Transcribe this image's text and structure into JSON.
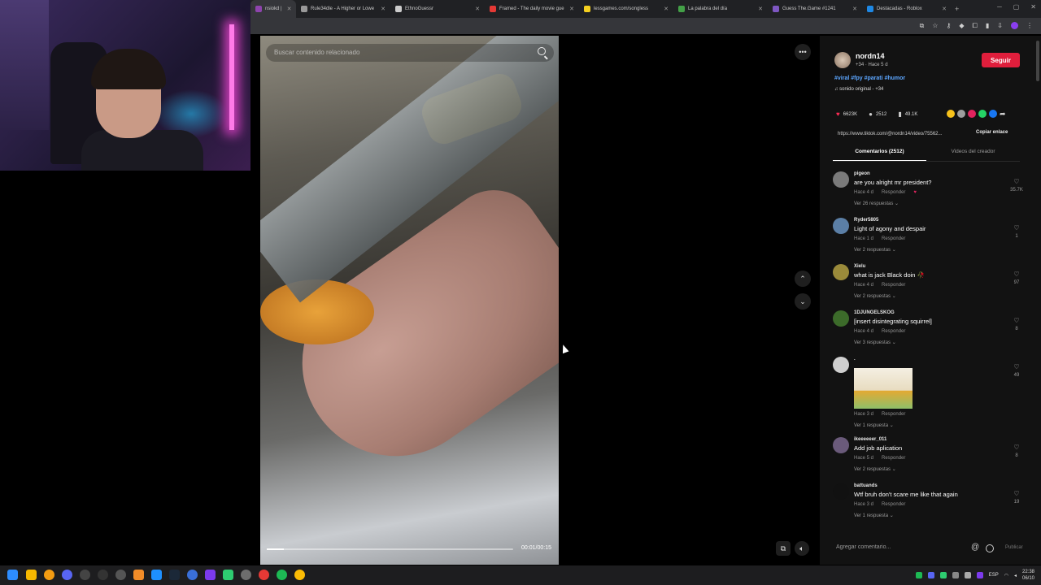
{
  "browser": {
    "tabs": [
      {
        "label": "nsiokd | ",
        "favicon_color": "#8e44ad",
        "active": true
      },
      {
        "label": "Rule34dle - A Higher or Lowe",
        "favicon_color": "#999999",
        "active": false
      },
      {
        "label": "EthnoGuessr",
        "favicon_color": "#cccccc",
        "active": false
      },
      {
        "label": "Framed - The daily movie gue",
        "favicon_color": "#e53935",
        "active": false
      },
      {
        "label": "lessgames.com/songless",
        "favicon_color": "#f5d020",
        "active": false
      },
      {
        "label": "La palabra del día",
        "favicon_color": "#43a047",
        "active": false
      },
      {
        "label": "Guess The.Game #1241",
        "favicon_color": "#7e57c2",
        "active": false
      },
      {
        "label": "Destacadas - Roblox",
        "favicon_color": "#1e88e5",
        "active": false
      }
    ]
  },
  "video": {
    "search_placeholder": "Buscar contenido relacionado",
    "time": "00:01/00:15",
    "progress": 0.07
  },
  "author": {
    "name": "nordn14",
    "meta": "+34 · Hace 5 d",
    "follow_label": "Seguir",
    "hashtags": "#viral #fpy #parati #humor",
    "sound": "♫  sonido original - +34"
  },
  "stats": {
    "likes": "6623K",
    "comments": "2512",
    "saves": "49.1K"
  },
  "share_colors": [
    "#f7c21b",
    "#9e9e9e",
    "#e0245e",
    "#25d366",
    "#1877f2"
  ],
  "link": {
    "url": "https://www.tiktok.com/@nordn14/video/75562...",
    "copy_label": "Copiar enlace"
  },
  "panel_tabs": {
    "comments": "Comentarios (2512)",
    "creator": "Videos del creador"
  },
  "comments": [
    {
      "user": "pigeon",
      "text": "are you alright mr president?",
      "meta": "Hace 4 d",
      "reply": "Responder",
      "replies": "Ver 26 respuestas ⌄",
      "likes": "35.7K",
      "avatar": "#7a7a7a"
    },
    {
      "user": "Ryder5805",
      "text": "Light of agony and despair",
      "meta": "Hace 1 d",
      "reply": "Responder",
      "replies": "Ver 2 respuestas ⌄",
      "likes": "1",
      "avatar": "#5b7fa6"
    },
    {
      "user": "Xielu",
      "text": "what is jack Black doin 🥀",
      "meta": "Hace 4 d",
      "reply": "Responder",
      "replies": "Ver 2 respuestas ⌄",
      "likes": "97",
      "avatar": "#9a8a3a"
    },
    {
      "user": "1DJUNGELSKOG",
      "text": "[insert disintegrating squirrel]",
      "meta": "Hace 4 d",
      "reply": "Responder",
      "replies": "Ver 3 respuestas ⌄",
      "likes": "8",
      "avatar": "#3c6b2a"
    },
    {
      "user": ".",
      "text": "",
      "meta": "Hace 3 d",
      "reply": "Responder",
      "replies": "Ver 1 respuesta ⌄",
      "likes": "49",
      "avatar": "#cfcfcf"
    },
    {
      "user": "ikeeeeeer_011",
      "text": "Add job aplication",
      "meta": "Hace 5 d",
      "reply": "Responder",
      "replies": "Ver 2 respuestas ⌄",
      "likes": "8",
      "avatar": "#6a5a7a"
    },
    {
      "user": "battuands",
      "text": "Wtf bruh don't scare me like that again",
      "meta": "Hace 3 d",
      "reply": "Responder",
      "replies": "Ver 1 respuesta ⌄",
      "likes": "19",
      "avatar": "#111111"
    }
  ],
  "composer": {
    "placeholder": "Agregar comentario...",
    "publish_label": "Publicar"
  },
  "taskbar": {
    "lang": "ESP",
    "time": "22:38",
    "date": "06/10"
  }
}
